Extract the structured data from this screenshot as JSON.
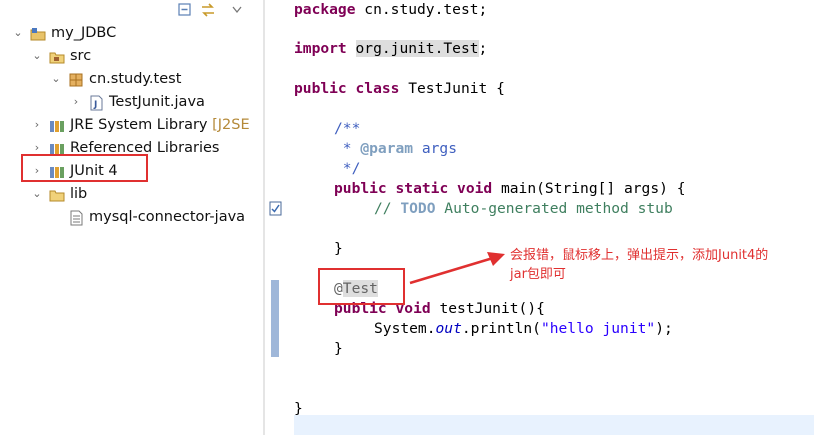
{
  "tree": {
    "rows": [
      {
        "label": "my_JDBC",
        "suffix": ""
      },
      {
        "label": "src",
        "suffix": ""
      },
      {
        "label": "cn.study.test",
        "suffix": ""
      },
      {
        "label": "TestJunit.java",
        "suffix": ""
      },
      {
        "label": "JRE System Library ",
        "suffix": "[J2SE"
      },
      {
        "label": "Referenced Libraries",
        "suffix": ""
      },
      {
        "label": "JUnit 4",
        "suffix": ""
      },
      {
        "label": "lib",
        "suffix": ""
      },
      {
        "label": "mysql-connector-java",
        "suffix": ""
      }
    ]
  },
  "code": {
    "package_kw": "package",
    "package_name": " cn.study.test;",
    "import_kw": "import",
    "import_name": "org.junit.Test",
    "import_semi": ";",
    "class_kw1": "public",
    "class_kw2": "class",
    "class_name": " TestJunit {",
    "doc_open": "/**",
    "doc_star": " * ",
    "doc_param_tag": "@param",
    "doc_param_name": " args",
    "doc_close": " */",
    "main_kw1": "public",
    "main_kw2": "static",
    "main_kw3": "void",
    "main_rest": " main(String[] args) {",
    "comment_prefix": "// ",
    "comment_todo": "TODO",
    "comment_rest": " Auto-generated method stub",
    "close_brace": "}",
    "annotation_at": "@",
    "annotation_name": "Test",
    "test_kw1": "public",
    "test_kw2": "void",
    "test_rest": " testJunit(){",
    "sysout_prefix": "System.",
    "sysout_field": "out",
    "sysout_mid": ".println(",
    "sysout_string": "\"hello junit\"",
    "sysout_end": ");",
    "method_close": "}",
    "class_close": "}"
  },
  "annotation": {
    "callout_line1": "会报错，鼠标移上，弹出提示，添加Junit4的",
    "callout_line2": "jar包即可"
  },
  "colors": {
    "red": "#e03030",
    "keyword": "#7f0055",
    "javadoc": "#3f5fbf",
    "comment": "#3f7f5f",
    "string": "#2a00ff"
  }
}
